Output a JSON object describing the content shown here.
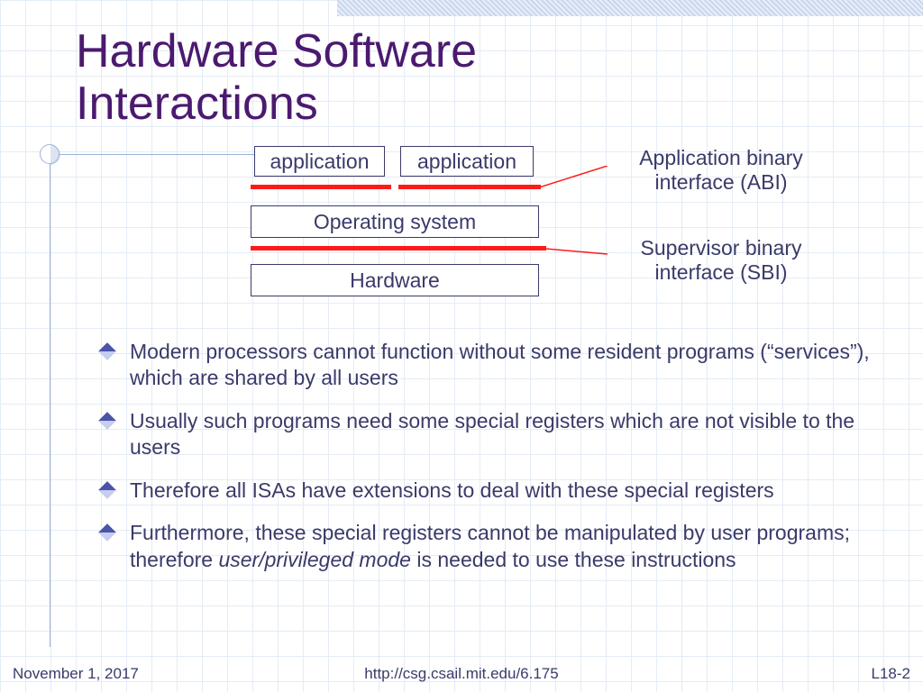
{
  "title_line1": "Hardware Software",
  "title_line2": "Interactions",
  "diagram": {
    "app1": "application",
    "app2": "application",
    "os": "Operating system",
    "hw": "Hardware",
    "abi": "Application binary interface (ABI)",
    "sbi": "Supervisor binary interface (SBI)"
  },
  "bullets": [
    "Modern processors cannot function without some resident programs (“services”), which are shared by all users",
    "Usually such programs need some special registers which are not visible to the users",
    "Therefore all ISAs have extensions to deal with these special registers"
  ],
  "bullet4_pre": "Furthermore, these special registers cannot be manipulated by user programs; therefore ",
  "bullet4_em": "user/privileged mode",
  "bullet4_post": " is needed to use these instructions",
  "footer": {
    "date": "November 1, 2017",
    "url": "http://csg.csail.mit.edu/6.175",
    "page": "L18-2"
  }
}
